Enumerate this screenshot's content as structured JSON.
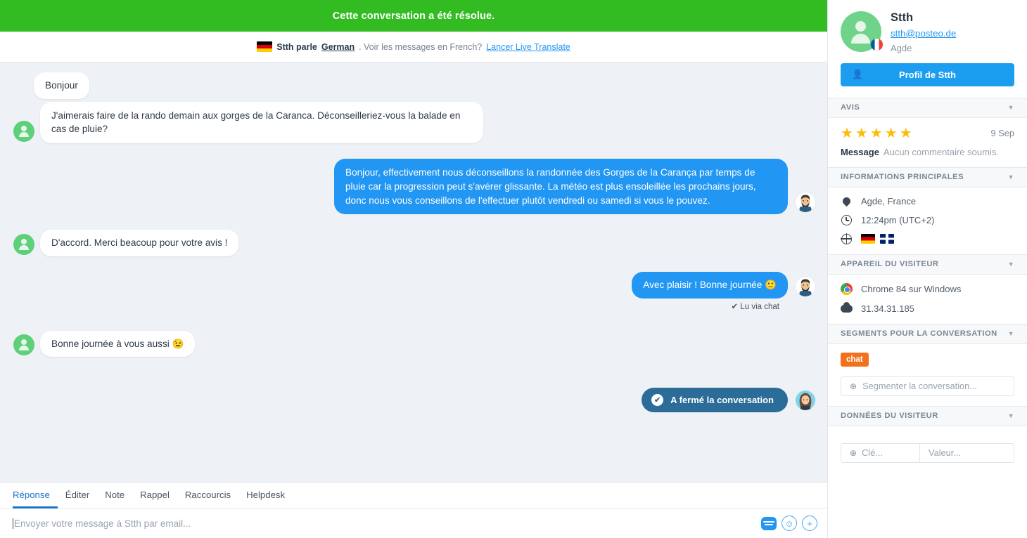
{
  "banner": {
    "resolved_text": "Cette conversation a été résolue."
  },
  "translate_bar": {
    "speaker_flag": "flag-de",
    "speaks_prefix": "Stth parle",
    "language": "German",
    "question": ". Voir les messages en French?",
    "link": "Lancer Live Translate"
  },
  "conversation": {
    "messages": [
      {
        "direction": "in",
        "text": "Bonjour"
      },
      {
        "direction": "in",
        "text": "J'aimerais faire de la rando demain aux gorges de la Caranca. Déconseilleriez-vous la balade en cas de pluie?"
      },
      {
        "direction": "out",
        "text": "Bonjour, effectivement nous déconseillons la randonnée des Gorges de la Carança par temps de pluie car la progression peut s'avérer glissante. La météo est plus ensoleillée les prochains jours, donc nous vous conseillons de l'effectuer plutôt vendredi ou samedi si vous le pouvez."
      },
      {
        "direction": "in",
        "text": "D'accord. Merci beacoup pour votre avis !"
      },
      {
        "direction": "out",
        "text": "Avec plaisir ! Bonne journée 🙂"
      },
      {
        "direction": "in",
        "text": "Bonne journée à vous aussi 😉"
      }
    ],
    "read_receipt": "✔ Lu via chat",
    "closed_event": "A fermé la conversation",
    "closed_icon": "check-circle-icon"
  },
  "composer": {
    "tabs": [
      {
        "label": "Réponse",
        "active": true
      },
      {
        "label": "Éditer",
        "active": false
      },
      {
        "label": "Note",
        "active": false
      },
      {
        "label": "Rappel",
        "active": false
      },
      {
        "label": "Raccourcis",
        "active": false
      },
      {
        "label": "Helpdesk",
        "active": false
      }
    ],
    "placeholder": "Envoyer votre message à Stth par email...",
    "icons": [
      "canned-response-icon",
      "emoji-icon",
      "attachment-plus-icon"
    ]
  },
  "sidebar": {
    "profile": {
      "name": "Stth",
      "email": "stth@posteo.de",
      "location": "Agde",
      "country_flag": "flag-fr",
      "button_label": "Profil de Stth",
      "button_icon": "user-icon"
    },
    "sections": [
      {
        "key": "avis",
        "title": "AVIS"
      },
      {
        "key": "infos",
        "title": "INFORMATIONS PRINCIPALES"
      },
      {
        "key": "device",
        "title": "APPAREIL DU VISITEUR"
      },
      {
        "key": "segments",
        "title": "SEGMENTS POUR LA CONVERSATION"
      },
      {
        "key": "data",
        "title": "DONNÉES DU VISITEUR"
      }
    ],
    "avis": {
      "stars": 5,
      "stars_glyphs": "★★★★★",
      "date": "9 Sep",
      "message_label": "Message",
      "message_value": "Aucun commentaire soumis."
    },
    "infos": {
      "location": "Agde, France",
      "time": "12:24pm (UTC+2)",
      "languages": [
        "flag-de",
        "flag-uk"
      ]
    },
    "device": {
      "browser": "Chrome 84 sur Windows",
      "ip": "31.34.31.185"
    },
    "segments": {
      "tags": [
        "chat"
      ],
      "input_placeholder": "Segmenter la conversation..."
    },
    "visitor_data": {
      "key_placeholder": "Clé...",
      "value_placeholder": "Valeur..."
    }
  },
  "colors": {
    "resolved_green": "#33bb22",
    "accent_blue": "#2196f3",
    "closed_pill": "#2b6c98",
    "tag_orange": "#f2711c",
    "star_yellow": "#fbbd08",
    "visitor_avatar_green": "#5fd07a"
  }
}
